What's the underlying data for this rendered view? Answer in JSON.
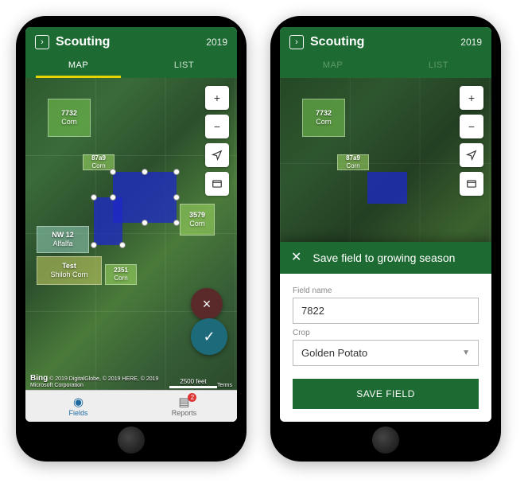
{
  "header": {
    "title": "Scouting",
    "year": "2019",
    "tabs": {
      "map": "MAP",
      "list": "LIST"
    }
  },
  "map": {
    "controls": {
      "zoom_in": "+",
      "zoom_out": "−",
      "locate": "➤",
      "layers": "▯"
    },
    "scale_label": "2500 feet",
    "attribution_brand": "Bing",
    "attribution_text": "© 2019 DigitalGlobe, © 2019 HERE, © 2019 Microsoft Corporation",
    "attribution_terms": "Terms"
  },
  "fields": [
    {
      "id": "7732",
      "crop": "Corn"
    },
    {
      "id": "87a9",
      "crop": "Corn"
    },
    {
      "id": "3579",
      "crop": "Corn"
    },
    {
      "id": "NW 12",
      "crop": "Alfalfa"
    },
    {
      "id": "Test",
      "crop": "Shiloh Corn"
    },
    {
      "id": "2351",
      "crop": "Corn"
    }
  ],
  "fab": {
    "cancel": "×",
    "confirm": "✓"
  },
  "nav": {
    "fields": "Fields",
    "reports": "Reports",
    "reports_badge": "2"
  },
  "modal": {
    "title": "Save field to growing season",
    "field_name_label": "Field name",
    "field_name_value": "7822",
    "crop_label": "Crop",
    "crop_value": "Golden Potato",
    "save_button": "SAVE FIELD"
  }
}
